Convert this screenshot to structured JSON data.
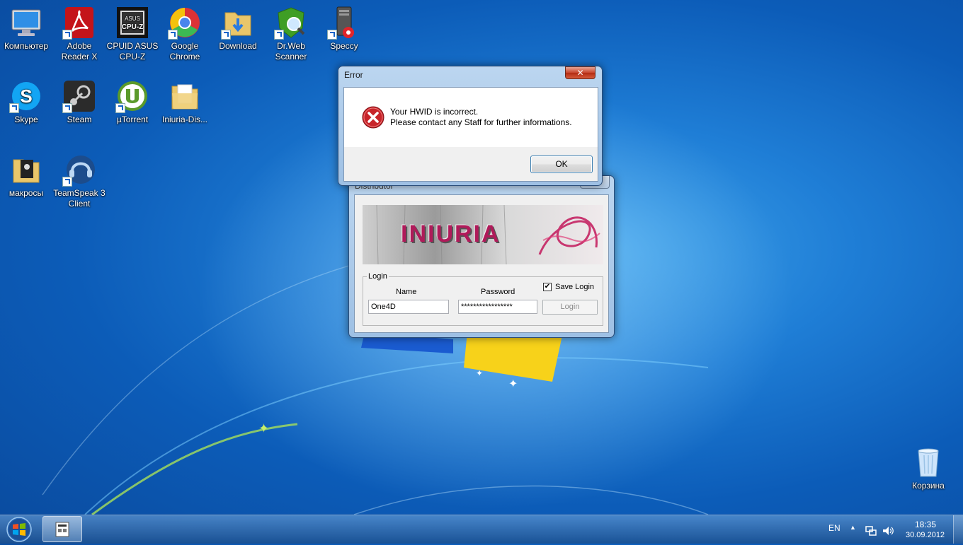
{
  "desktop": {
    "icons": [
      {
        "label": "Компьютер",
        "icon": "computer-icon"
      },
      {
        "label": "Adobe\nReader X",
        "icon": "adobe-reader-icon"
      },
      {
        "label": "CPUID ASUS\nCPU-Z",
        "icon": "cpuz-icon"
      },
      {
        "label": "Google\nChrome",
        "icon": "chrome-icon"
      },
      {
        "label": "Download",
        "icon": "folder-download-icon"
      },
      {
        "label": "Dr.Web\nScanner",
        "icon": "drweb-icon"
      },
      {
        "label": "Speccy",
        "icon": "speccy-icon"
      },
      {
        "label": "Skype",
        "icon": "skype-icon"
      },
      {
        "label": "Steam",
        "icon": "steam-icon"
      },
      {
        "label": "µTorrent",
        "icon": "utorrent-icon"
      },
      {
        "label": "Iniuria-Dis...",
        "icon": "folder-icon"
      },
      {
        "label": "макросы",
        "icon": "folder-icon"
      },
      {
        "label": "TeamSpeak 3\nClient",
        "icon": "teamspeak-icon"
      },
      {
        "label": "Корзина",
        "icon": "recycle-bin-icon"
      }
    ]
  },
  "error_dialog": {
    "title": "Error",
    "close_glyph": "✕",
    "message_line1": "Your HWID is incorrect.",
    "message_line2": "Please contact any Staff for further informations.",
    "ok_label": "OK"
  },
  "distributor": {
    "title": "Distributor",
    "banner_text": "INIURIA",
    "group_label": "Login",
    "name_label": "Name",
    "password_label": "Password",
    "name_value": "One4D",
    "password_value": "*****************",
    "save_login_label": "Save Login",
    "save_login_checked": true,
    "login_button": "Login"
  },
  "taskbar": {
    "language": "EN",
    "time": "18:35",
    "date": "30.09.2012"
  },
  "colors": {
    "error_red": "#c8242a",
    "banner_pink": "#b01a5a"
  }
}
